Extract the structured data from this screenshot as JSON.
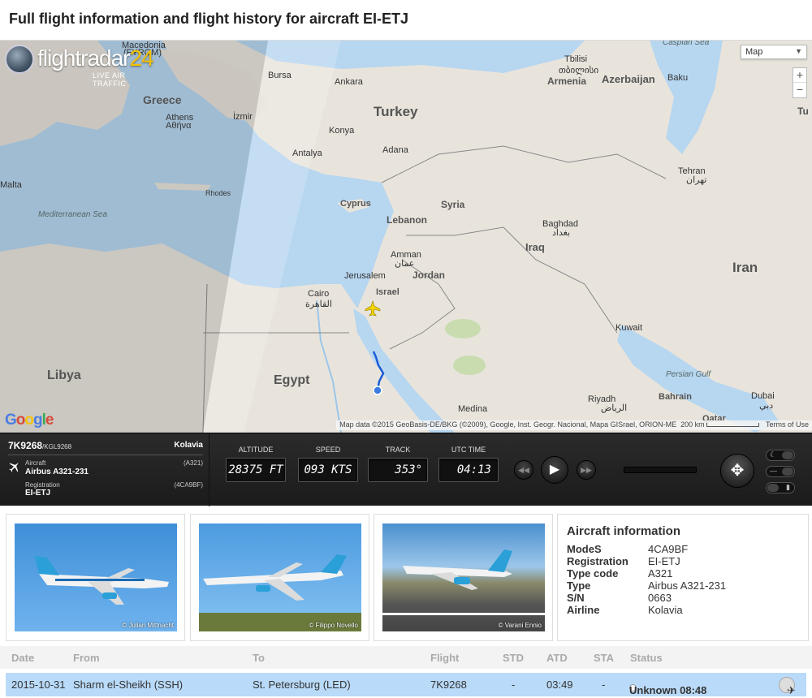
{
  "page": {
    "title": "Full flight information and flight history for aircraft EI-ETJ"
  },
  "map": {
    "brand": "flightradar",
    "brand_number": "24",
    "tagline": "LIVE AIR TRAFFIC",
    "map_type": "Map",
    "zoom_in": "+",
    "zoom_out": "−",
    "google": "Google",
    "attribution": "Map data ©2015 GeoBasis-DE/BKG (©2009), Google, Inst. Geogr. Nacional, Mapa GISrael, ORION-ME",
    "scale": "200 km",
    "terms": "Terms of Use",
    "labels": {
      "macedonia": "Macedonia",
      "fyrom": "(FYROM)",
      "bursa": "Bursa",
      "ankara": "Ankara",
      "tbilisi": "Tbilisi",
      "tbilisi_local": "თბილისი",
      "caspian": "Caspian Sea",
      "greece": "Greece",
      "izmir": "İzmir",
      "athens": "Athens",
      "athens_local": "Αθήνα",
      "turkey": "Turkey",
      "armenia": "Armenia",
      "azerbaijan": "Azerbaijan",
      "baku": "Baku",
      "konya": "Konya",
      "antalya": "Antalya",
      "adana": "Adana",
      "malta": "Malta",
      "modes_island": "Rhodes",
      "cyprus": "Cyprus",
      "syria": "Syria",
      "tehran": "Tehran",
      "tehran_local": "تهران",
      "med_sea": "Mediterranean Sea",
      "lebanon": "Lebanon",
      "baghdad": "Baghdad",
      "baghdad_local": "بغداد",
      "amman": "Amman",
      "amman_local": "عمان",
      "iraq": "Iraq",
      "jerusalem": "Jerusalem",
      "jordan": "Jordan",
      "israel": "Israel",
      "iran": "Iran",
      "cairo": "Cairo",
      "cairo_local": "القاهرة",
      "kuwait": "Kuwait",
      "libya": "Libya",
      "egypt": "Egypt",
      "persian_gulf": "Persian Gulf",
      "riyadh": "Riyadh",
      "riyadh_local": "الرياض",
      "bahrain": "Bahrain",
      "dubai": "Dubai",
      "dubai_local": "دبي",
      "medina": "Medina",
      "qatar": "Qatar",
      "tu": "Tu"
    }
  },
  "flight": {
    "callsign": "7K9268",
    "callsign_icao": "/KGL9268",
    "airline": "Kolavia",
    "aircraft_label": "Aircraft",
    "aircraft": "Airbus A321-231",
    "aircraft_code": "(A321)",
    "registration_label": "Registration",
    "registration": "EI-ETJ",
    "modes": "(4CA9BF)",
    "altitude_label": "ALTITUDE",
    "altitude": "28375 FT",
    "speed_label": "SPEED",
    "speed": "093 KTS",
    "track_label": "TRACK",
    "track": "353°",
    "time_label": "UTC TIME",
    "time": "04:13",
    "progress": 0.0
  },
  "photos": [
    {
      "credit": "© Julian Mittnacht"
    },
    {
      "credit": "© Filippo Novello"
    },
    {
      "credit": "© Varani Ennio"
    }
  ],
  "aircraft_info": {
    "heading": "Aircraft information",
    "rows": [
      {
        "key": "ModeS",
        "value": "4CA9BF"
      },
      {
        "key": "Registration",
        "value": "EI-ETJ"
      },
      {
        "key": "Type code",
        "value": "A321"
      },
      {
        "key": "Type",
        "value": "Airbus A321-231"
      },
      {
        "key": "S/N",
        "value": "0663"
      },
      {
        "key": "Airline",
        "value": "Kolavia"
      }
    ]
  },
  "history": {
    "headers": {
      "date": "Date",
      "from": "From",
      "to": "To",
      "flight": "Flight",
      "std": "STD",
      "atd": "ATD",
      "sta": "STA",
      "status": "Status"
    },
    "rows": [
      {
        "date": "2015-10-31",
        "from": "Sharm el-Sheikh (SSH)",
        "to": "St. Petersburg (LED)",
        "flight": "7K9268",
        "std": "-",
        "atd": "03:49",
        "sta": "-",
        "status": "Unknown 08:48"
      }
    ]
  },
  "colors": {
    "sea": "#b7d6f0",
    "land": "#e8e4dc",
    "selected_row": "#b9daf8",
    "flight_path": "#1b5cd6",
    "plane": "#f5d400"
  }
}
